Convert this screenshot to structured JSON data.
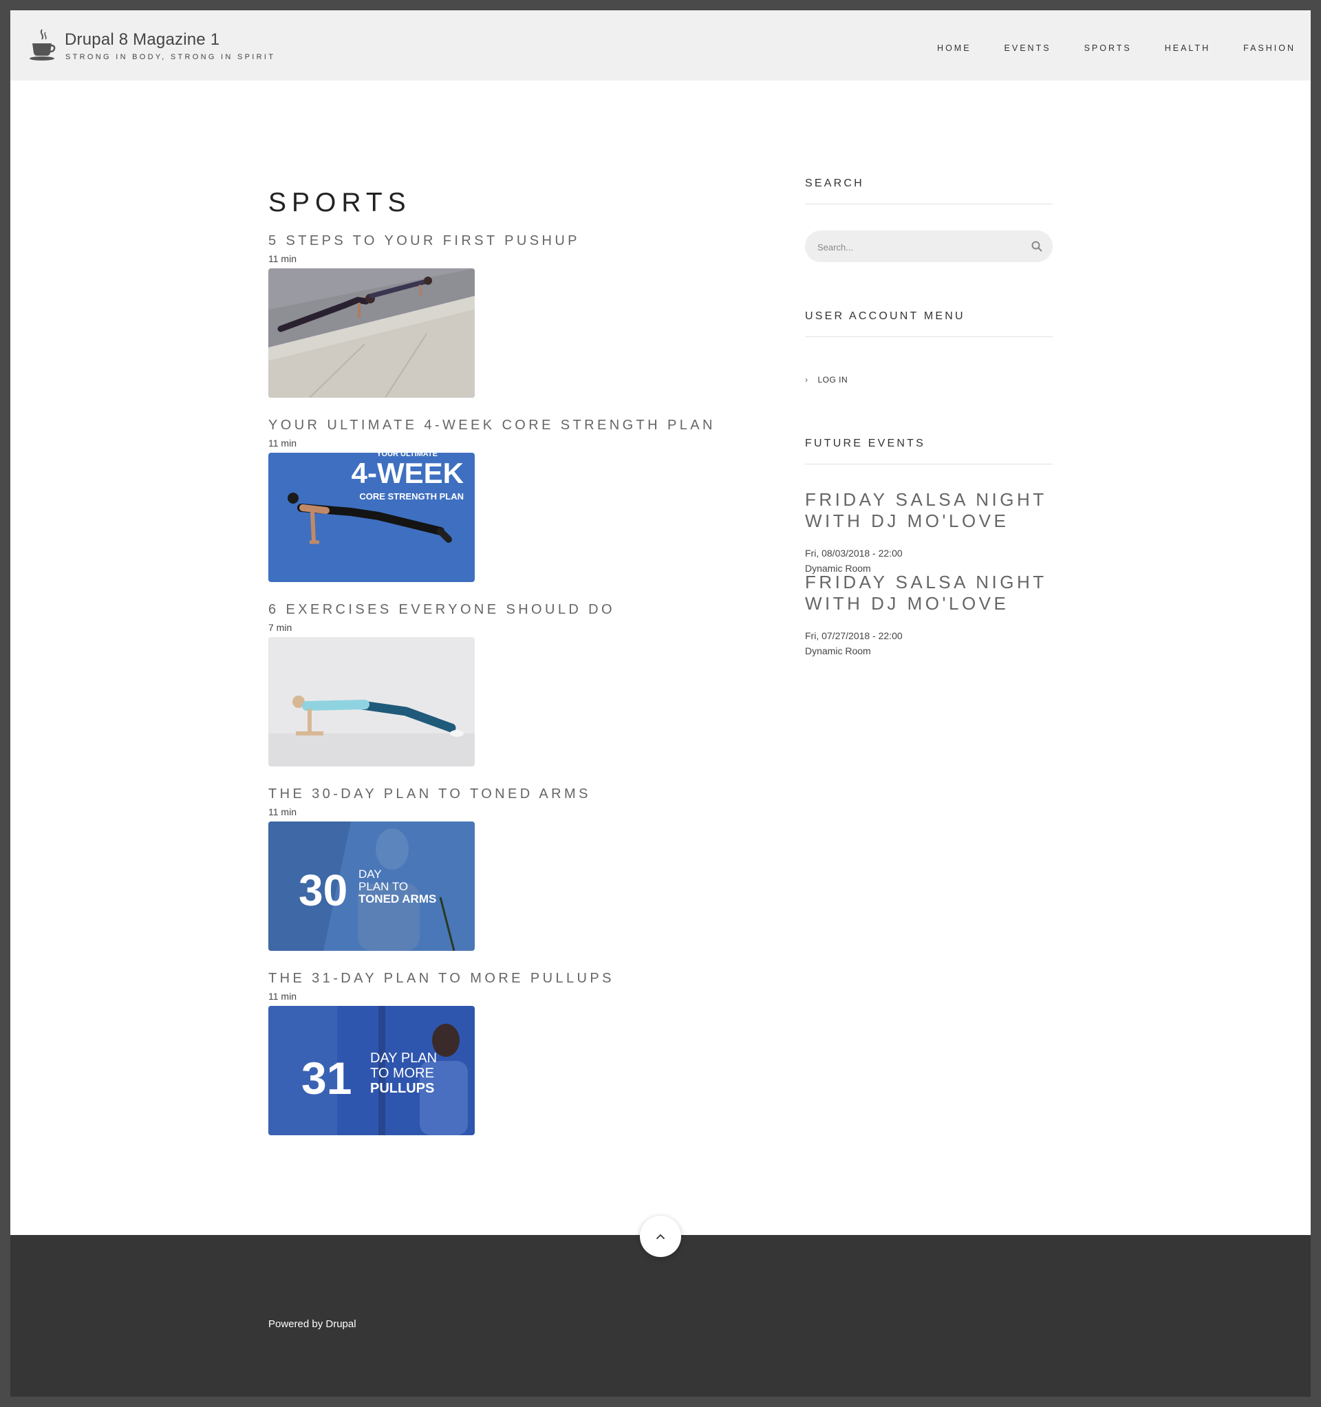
{
  "site": {
    "name": "Drupal 8 Magazine 1",
    "slogan": "STRONG IN BODY, STRONG IN SPIRIT"
  },
  "nav": {
    "items": [
      "HOME",
      "EVENTS",
      "SPORTS",
      "HEALTH",
      "FASHION"
    ]
  },
  "page": {
    "title": "SPORTS"
  },
  "articles": [
    {
      "title": "5 STEPS TO YOUR FIRST PUSHUP",
      "read_time": "11 min",
      "image_icon": "pushup-photo"
    },
    {
      "title": "YOUR ULTIMATE 4-WEEK CORE STRENGTH PLAN",
      "read_time": "11 min",
      "image_icon": "core-plan-photo",
      "image_text": {
        "top": "YOUR ULTIMATE",
        "big": "4-WEEK",
        "sub": "CORE STRENGTH PLAN"
      }
    },
    {
      "title": "6 EXERCISES EVERYONE SHOULD DO",
      "read_time": "7 min",
      "image_icon": "plank-photo"
    },
    {
      "title": "THE 30-DAY PLAN TO TONED ARMS",
      "read_time": "11 min",
      "image_icon": "arms-plan-photo",
      "image_text": {
        "num": "30",
        "l1": "DAY",
        "l2": "PLAN TO",
        "l3": "TONED ARMS"
      }
    },
    {
      "title": "THE 31-DAY PLAN TO MORE PULLUPS",
      "read_time": "11 min",
      "image_icon": "pullups-plan-photo",
      "image_text": {
        "num": "31",
        "l1": "DAY PLAN",
        "l2": "TO MORE",
        "l3": "PULLUPS"
      }
    }
  ],
  "sidebar": {
    "search": {
      "title": "SEARCH",
      "placeholder": "Search..."
    },
    "user_menu": {
      "title": "USER ACCOUNT MENU",
      "login": "LOG IN"
    },
    "events": {
      "title": "FUTURE EVENTS",
      "items": [
        {
          "title_line1": "FRIDAY SALSA NIGHT",
          "title_line2": "WITH DJ MO'LOVE",
          "date": "Fri, 08/03/2018 - 22:00",
          "room": "Dynamic Room"
        },
        {
          "title_line1": "FRIDAY SALSA NIGHT",
          "title_line2": "WITH DJ MO'LOVE",
          "date": "Fri, 07/27/2018 - 22:00",
          "room": "Dynamic Room"
        }
      ]
    }
  },
  "footer": {
    "powered": "Powered by Drupal"
  },
  "colors": {
    "header_bg": "#f0f0f0",
    "footer_bg": "#363636",
    "image_blue": "#3f6fc0"
  }
}
